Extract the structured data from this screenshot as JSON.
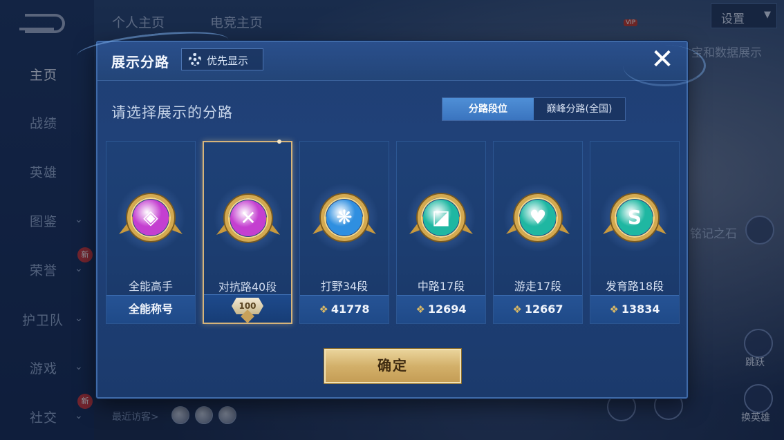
{
  "background": {
    "nav_items": [
      "主页",
      "战绩",
      "英雄",
      "图鉴",
      "荣誉",
      "护卫队",
      "游戏",
      "社交"
    ],
    "new_badge": "新",
    "top_tabs": [
      "个人主页",
      "电竞主页"
    ],
    "settings_label": "设置",
    "vip_badge": "VIP",
    "peek_texts": [
      "宝和数据展示",
      "铭记之石"
    ],
    "recent_visitors_label": "最近访客>",
    "jump_label": "跳跃",
    "switch_hero_label": "换英雄"
  },
  "modal": {
    "title": "展示分路",
    "priority_label": "优先显示",
    "close_symbol": "✕",
    "prompt": "请选择展示的分路",
    "segments": [
      "分路段位",
      "巅峰分路(全国)"
    ],
    "active_segment": "分路段位",
    "confirm_label": "确定",
    "cards": [
      {
        "name": "全能高手",
        "footer": "全能称号",
        "points": null,
        "emblem_color": "#c43fd0",
        "emblem_glyph": "◈",
        "selected": false
      },
      {
        "name": "对抗路40段",
        "footer": null,
        "rank_number": "100",
        "points": null,
        "emblem_color": "#c43fd0",
        "emblem_glyph": "✕",
        "selected": true
      },
      {
        "name": "打野34段",
        "footer": null,
        "points": "41778",
        "emblem_color": "#2f8fe0",
        "emblem_glyph": "❋",
        "selected": false
      },
      {
        "name": "中路17段",
        "footer": null,
        "points": "12694",
        "emblem_color": "#1fb7a2",
        "emblem_glyph": "◪",
        "selected": false
      },
      {
        "name": "游走17段",
        "footer": null,
        "points": "12667",
        "emblem_color": "#1fb7a2",
        "emblem_glyph": "♥",
        "selected": false
      },
      {
        "name": "发育路18段",
        "footer": null,
        "points": "13834",
        "emblem_color": "#1fb7a2",
        "emblem_glyph": "S",
        "selected": false
      }
    ]
  }
}
